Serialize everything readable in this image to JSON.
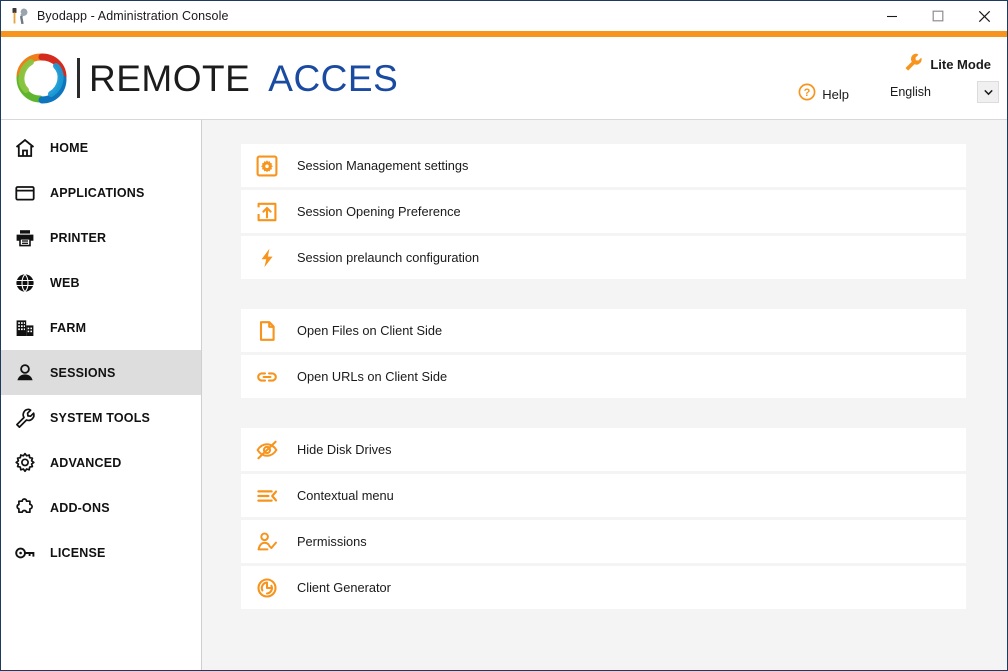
{
  "window": {
    "title": "Byodapp - Administration Console",
    "app_icon": "tools-icon",
    "controls": {
      "minimize": "minimize-icon",
      "maximize": "maximize-icon",
      "close": "close-icon"
    }
  },
  "header": {
    "logo": {
      "mark": "swirl-logo-icon",
      "primary_text": "REMOTE",
      "secondary_text": "ACCES",
      "primary_color": "#1c1c1c",
      "secondary_color": "#1b4ba0"
    },
    "lite_mode": {
      "label": "Lite Mode",
      "icon": "wrench-icon"
    },
    "help": {
      "label": "Help",
      "icon": "question-circle-icon"
    },
    "language": {
      "value": "English",
      "icon": "chevron-down-icon"
    }
  },
  "colors": {
    "accent_orange": "#f7941d",
    "brand_blue": "#1b4ba0",
    "window_border": "#1f3a5f",
    "content_bg": "#f4f4f4",
    "active_nav_bg": "#dddddd"
  },
  "sidebar": {
    "items": [
      {
        "label": "HOME",
        "icon": "home-icon",
        "active": false
      },
      {
        "label": "APPLICATIONS",
        "icon": "window-icon",
        "active": false
      },
      {
        "label": "PRINTER",
        "icon": "printer-icon",
        "active": false
      },
      {
        "label": "WEB",
        "icon": "globe-icon",
        "active": false
      },
      {
        "label": "FARM",
        "icon": "building-icon",
        "active": false
      },
      {
        "label": "SESSIONS",
        "icon": "user-icon",
        "active": true
      },
      {
        "label": "SYSTEM TOOLS",
        "icon": "wrench-icon",
        "active": false
      },
      {
        "label": "ADVANCED",
        "icon": "gear-icon",
        "active": false
      },
      {
        "label": "ADD-ONS",
        "icon": "puzzle-icon",
        "active": false
      },
      {
        "label": "LICENSE",
        "icon": "key-icon",
        "active": false
      }
    ]
  },
  "main": {
    "groups": [
      {
        "rows": [
          {
            "label": "Session Management settings",
            "icon": "gear-in-square-icon"
          },
          {
            "label": "Session Opening Preference",
            "icon": "upload-in-square-icon"
          },
          {
            "label": "Session prelaunch configuration",
            "icon": "lightning-bolt-icon"
          }
        ]
      },
      {
        "rows": [
          {
            "label": "Open Files on Client Side",
            "icon": "document-icon"
          },
          {
            "label": "Open URLs on Client Side",
            "icon": "link-icon"
          }
        ]
      },
      {
        "rows": [
          {
            "label": "Hide Disk Drives",
            "icon": "eye-slash-icon"
          },
          {
            "label": "Contextual menu",
            "icon": "menu-collapse-icon"
          },
          {
            "label": "Permissions",
            "icon": "user-check-icon"
          },
          {
            "label": "Client Generator",
            "icon": "client-generator-icon"
          }
        ]
      }
    ]
  }
}
